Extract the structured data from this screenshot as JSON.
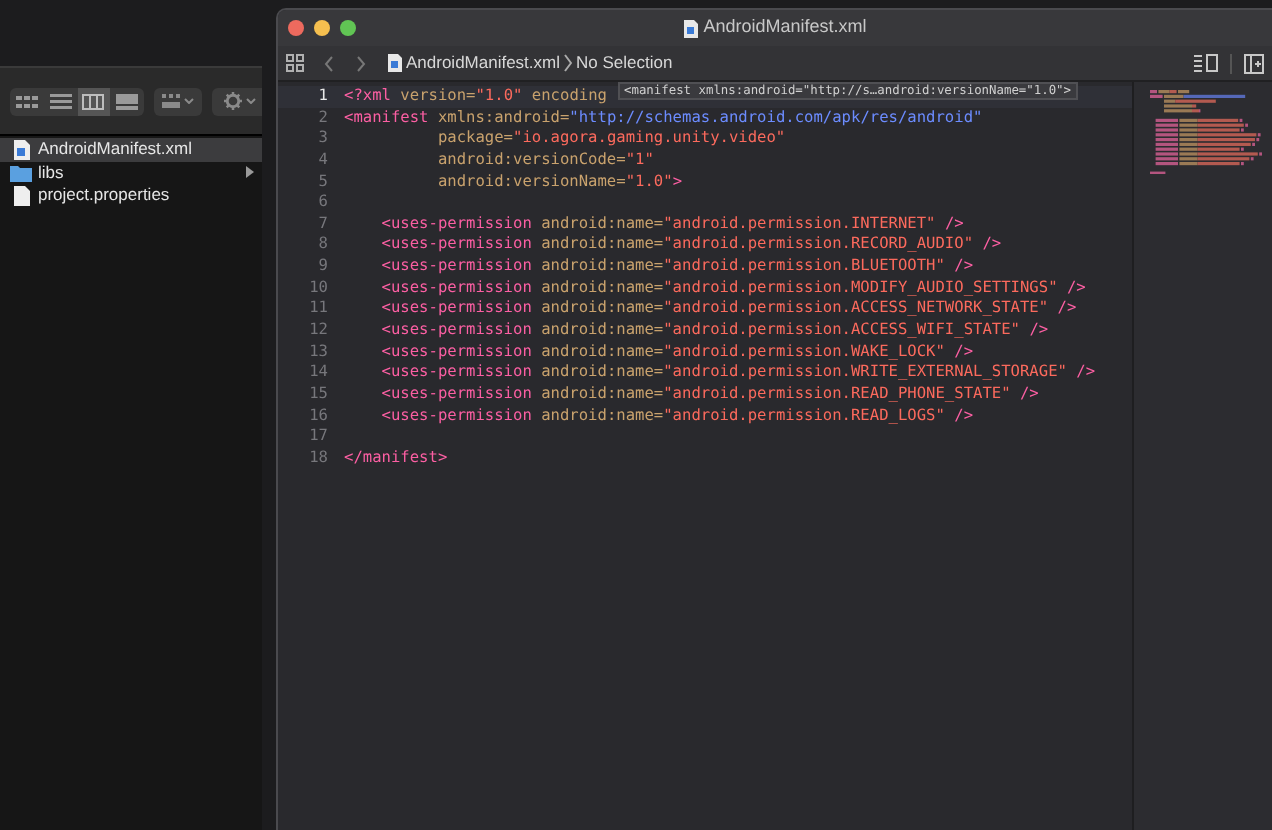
{
  "finder": {
    "view_modes": [
      {
        "kind": "icons",
        "selected": false
      },
      {
        "kind": "list",
        "selected": false
      },
      {
        "kind": "columns",
        "selected": true
      },
      {
        "kind": "gallery",
        "selected": false
      }
    ],
    "files": [
      {
        "name": "AndroidManifest.xml",
        "kind": "xml",
        "selected": true
      },
      {
        "name": "libs",
        "kind": "folder",
        "selected": false
      },
      {
        "name": "project.properties",
        "kind": "document",
        "selected": false
      }
    ]
  },
  "editor": {
    "window_title": "AndroidManifest.xml",
    "breadcrumb": [
      "AndroidManifest.xml",
      "No Selection"
    ],
    "tooltip": "<manifest xmlns:android=\"http://s…android:versionName=\"1.0\">",
    "lines": [
      {
        "number": "1",
        "current": true,
        "tokens": [
          {
            "kind": "tag",
            "text": "<?xml"
          },
          {
            "kind": "attr",
            "text": " version="
          },
          {
            "kind": "string",
            "text": "\"1.0\""
          },
          {
            "kind": "attr",
            "text": " encoding"
          }
        ]
      },
      {
        "number": "2",
        "current": false,
        "tokens": [
          {
            "kind": "tag",
            "text": "<manifest"
          },
          {
            "kind": "attr",
            "text": " xmlns:android="
          },
          {
            "kind": "url",
            "text": "\"http://schemas.android.com/apk/res/android\""
          }
        ]
      },
      {
        "number": "3",
        "current": false,
        "tokens": [
          {
            "kind": "attr",
            "text": "          package="
          },
          {
            "kind": "string",
            "text": "\"io.agora.gaming.unity.video\""
          }
        ]
      },
      {
        "number": "4",
        "current": false,
        "tokens": [
          {
            "kind": "attr",
            "text": "          android:versionCode="
          },
          {
            "kind": "string",
            "text": "\"1\""
          }
        ]
      },
      {
        "number": "5",
        "current": false,
        "tokens": [
          {
            "kind": "attr",
            "text": "          android:versionName="
          },
          {
            "kind": "string",
            "text": "\"1.0\""
          },
          {
            "kind": "tag",
            "text": ">"
          }
        ]
      },
      {
        "number": "6",
        "current": false
      },
      {
        "number": "7",
        "current": false,
        "tokens": [
          {
            "kind": "tag",
            "text": "    <uses-permission"
          },
          {
            "kind": "attr",
            "text": " android:name="
          },
          {
            "kind": "string",
            "text": "\"android.permission.INTERNET\""
          },
          {
            "kind": "tag",
            "text": " />"
          }
        ]
      },
      {
        "number": "8",
        "current": false,
        "tokens": [
          {
            "kind": "tag",
            "text": "    <uses-permission"
          },
          {
            "kind": "attr",
            "text": " android:name="
          },
          {
            "kind": "string",
            "text": "\"android.permission.RECORD_AUDIO\""
          },
          {
            "kind": "tag",
            "text": " />"
          }
        ]
      },
      {
        "number": "9",
        "current": false,
        "tokens": [
          {
            "kind": "tag",
            "text": "    <uses-permission"
          },
          {
            "kind": "attr",
            "text": " android:name="
          },
          {
            "kind": "string",
            "text": "\"android.permission.BLUETOOTH\""
          },
          {
            "kind": "tag",
            "text": " />"
          }
        ]
      },
      {
        "number": "10",
        "current": false,
        "tokens": [
          {
            "kind": "tag",
            "text": "    <uses-permission"
          },
          {
            "kind": "attr",
            "text": " android:name="
          },
          {
            "kind": "string",
            "text": "\"android.permission.MODIFY_AUDIO_SETTINGS\""
          },
          {
            "kind": "tag",
            "text": " />"
          }
        ]
      },
      {
        "number": "11",
        "current": false,
        "tokens": [
          {
            "kind": "tag",
            "text": "    <uses-permission"
          },
          {
            "kind": "attr",
            "text": " android:name="
          },
          {
            "kind": "string",
            "text": "\"android.permission.ACCESS_NETWORK_STATE\""
          },
          {
            "kind": "tag",
            "text": " />"
          }
        ]
      },
      {
        "number": "12",
        "current": false,
        "tokens": [
          {
            "kind": "tag",
            "text": "    <uses-permission"
          },
          {
            "kind": "attr",
            "text": " android:name="
          },
          {
            "kind": "string",
            "text": "\"android.permission.ACCESS_WIFI_STATE\""
          },
          {
            "kind": "tag",
            "text": " />"
          }
        ]
      },
      {
        "number": "13",
        "current": false,
        "tokens": [
          {
            "kind": "tag",
            "text": "    <uses-permission"
          },
          {
            "kind": "attr",
            "text": " android:name="
          },
          {
            "kind": "string",
            "text": "\"android.permission.WAKE_LOCK\""
          },
          {
            "kind": "tag",
            "text": " />"
          }
        ]
      },
      {
        "number": "14",
        "current": false,
        "tokens": [
          {
            "kind": "tag",
            "text": "    <uses-permission"
          },
          {
            "kind": "attr",
            "text": " android:name="
          },
          {
            "kind": "string",
            "text": "\"android.permission.WRITE_EXTERNAL_STORAGE\""
          },
          {
            "kind": "tag",
            "text": " />"
          }
        ]
      },
      {
        "number": "15",
        "current": false,
        "tokens": [
          {
            "kind": "tag",
            "text": "    <uses-permission"
          },
          {
            "kind": "attr",
            "text": " android:name="
          },
          {
            "kind": "string",
            "text": "\"android.permission.READ_PHONE_STATE\""
          },
          {
            "kind": "tag",
            "text": " />"
          }
        ]
      },
      {
        "number": "16",
        "current": false,
        "tokens": [
          {
            "kind": "tag",
            "text": "    <uses-permission"
          },
          {
            "kind": "attr",
            "text": " android:name="
          },
          {
            "kind": "string",
            "text": "\"android.permission.READ_LOGS\""
          },
          {
            "kind": "tag",
            "text": " />"
          }
        ]
      },
      {
        "number": "17",
        "current": false
      },
      {
        "number": "18",
        "current": false,
        "tokens": [
          {
            "kind": "tag",
            "text": "</manifest>"
          }
        ]
      }
    ]
  }
}
